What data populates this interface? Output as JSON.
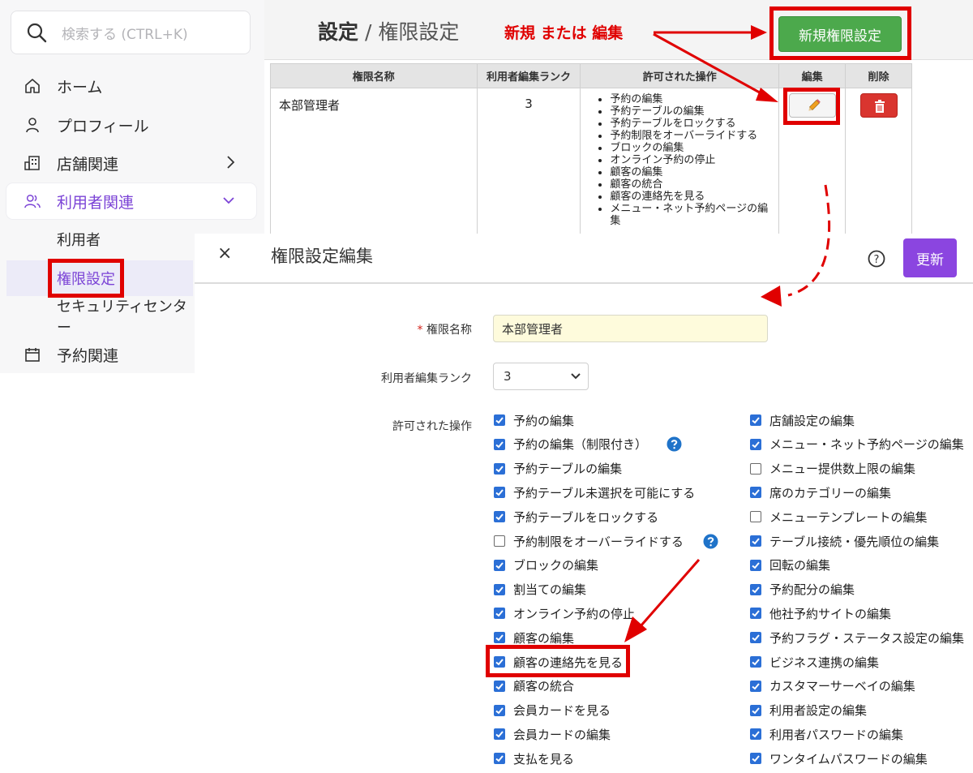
{
  "sidebar": {
    "search_placeholder": "検索する (CTRL+K)",
    "items": [
      {
        "label": "ホーム",
        "icon": "home-icon"
      },
      {
        "label": "プロフィール",
        "icon": "user-icon"
      },
      {
        "label": "店舗関連",
        "icon": "building-icon"
      },
      {
        "label": "利用者関連",
        "icon": "users-icon"
      },
      {
        "label": "予約関連",
        "icon": "calendar-icon"
      }
    ],
    "sub_items": [
      {
        "label": "利用者"
      },
      {
        "label": "権限設定"
      },
      {
        "label": "セキュリティセンター"
      }
    ]
  },
  "header": {
    "title_main": "設定",
    "separator": " / ",
    "title_sub": "権限設定",
    "annotation": "新規 または 編集",
    "new_button": "新規権限設定"
  },
  "permission_table": {
    "columns": [
      "権限名称",
      "利用者編集ランク",
      "許可された操作",
      "編集",
      "削除"
    ],
    "row": {
      "name": "本部管理者",
      "rank": "3",
      "operations": [
        "予約の編集",
        "予約テーブルの編集",
        "予約テーブルをロックする",
        "予約制限をオーバーライドする",
        "ブロックの編集",
        "オンライン予約の停止",
        "顧客の編集",
        "顧客の統合",
        "顧客の連絡先を見る",
        "メニュー・ネット予約ページの編集"
      ]
    }
  },
  "dialog": {
    "close": "×",
    "title": "権限設定編集",
    "help": "?",
    "update_button": "更新",
    "name_label": "権限名称",
    "required_mark": "*",
    "name_value": "本部管理者",
    "rank_label": "利用者編集ランク",
    "rank_value": "3",
    "ops_label": "許可された操作",
    "left_ops": [
      {
        "label": "予約の編集",
        "checked": true,
        "help": false
      },
      {
        "label": "予約の編集（制限付き）",
        "checked": true,
        "help": true
      },
      {
        "label": "予約テーブルの編集",
        "checked": true,
        "help": false
      },
      {
        "label": "予約テーブル未選択を可能にする",
        "checked": true,
        "help": false
      },
      {
        "label": "予約テーブルをロックする",
        "checked": true,
        "help": false
      },
      {
        "label": "予約制限をオーバーライドする",
        "checked": false,
        "help": true
      },
      {
        "label": "ブロックの編集",
        "checked": true,
        "help": false
      },
      {
        "label": "割当ての編集",
        "checked": true,
        "help": false
      },
      {
        "label": "オンライン予約の停止",
        "checked": true,
        "help": false
      },
      {
        "label": "顧客の編集",
        "checked": true,
        "help": false
      },
      {
        "label": "顧客の連絡先を見る",
        "checked": true,
        "help": false
      },
      {
        "label": "顧客の統合",
        "checked": true,
        "help": false
      },
      {
        "label": "会員カードを見る",
        "checked": true,
        "help": false
      },
      {
        "label": "会員カードの編集",
        "checked": true,
        "help": false
      },
      {
        "label": "支払を見る",
        "checked": true,
        "help": false
      }
    ],
    "right_ops": [
      {
        "label": "店舗設定の編集",
        "checked": true
      },
      {
        "label": "メニュー・ネット予約ページの編集",
        "checked": true
      },
      {
        "label": "メニュー提供数上限の編集",
        "checked": false
      },
      {
        "label": "席のカテゴリーの編集",
        "checked": true
      },
      {
        "label": "メニューテンプレートの編集",
        "checked": false
      },
      {
        "label": "テーブル接続・優先順位の編集",
        "checked": true
      },
      {
        "label": "回転の編集",
        "checked": true
      },
      {
        "label": "予約配分の編集",
        "checked": true
      },
      {
        "label": "他社予約サイトの編集",
        "checked": true
      },
      {
        "label": "予約フラグ・ステータス設定の編集",
        "checked": true
      },
      {
        "label": "ビジネス連携の編集",
        "checked": true
      },
      {
        "label": "カスタマーサーベイの編集",
        "checked": true
      },
      {
        "label": "利用者設定の編集",
        "checked": true
      },
      {
        "label": "利用者パスワードの編集",
        "checked": true
      },
      {
        "label": "ワンタイムパスワードの編集",
        "checked": true
      }
    ]
  },
  "colors": {
    "accent": "#7b43d6",
    "annotation_red": "#e00000",
    "new_button_green": "#4ca94c",
    "update_button_purple": "#8b45e0",
    "checkbox_blue": "#2b6fd6",
    "name_input_bg": "#fefbdc"
  }
}
